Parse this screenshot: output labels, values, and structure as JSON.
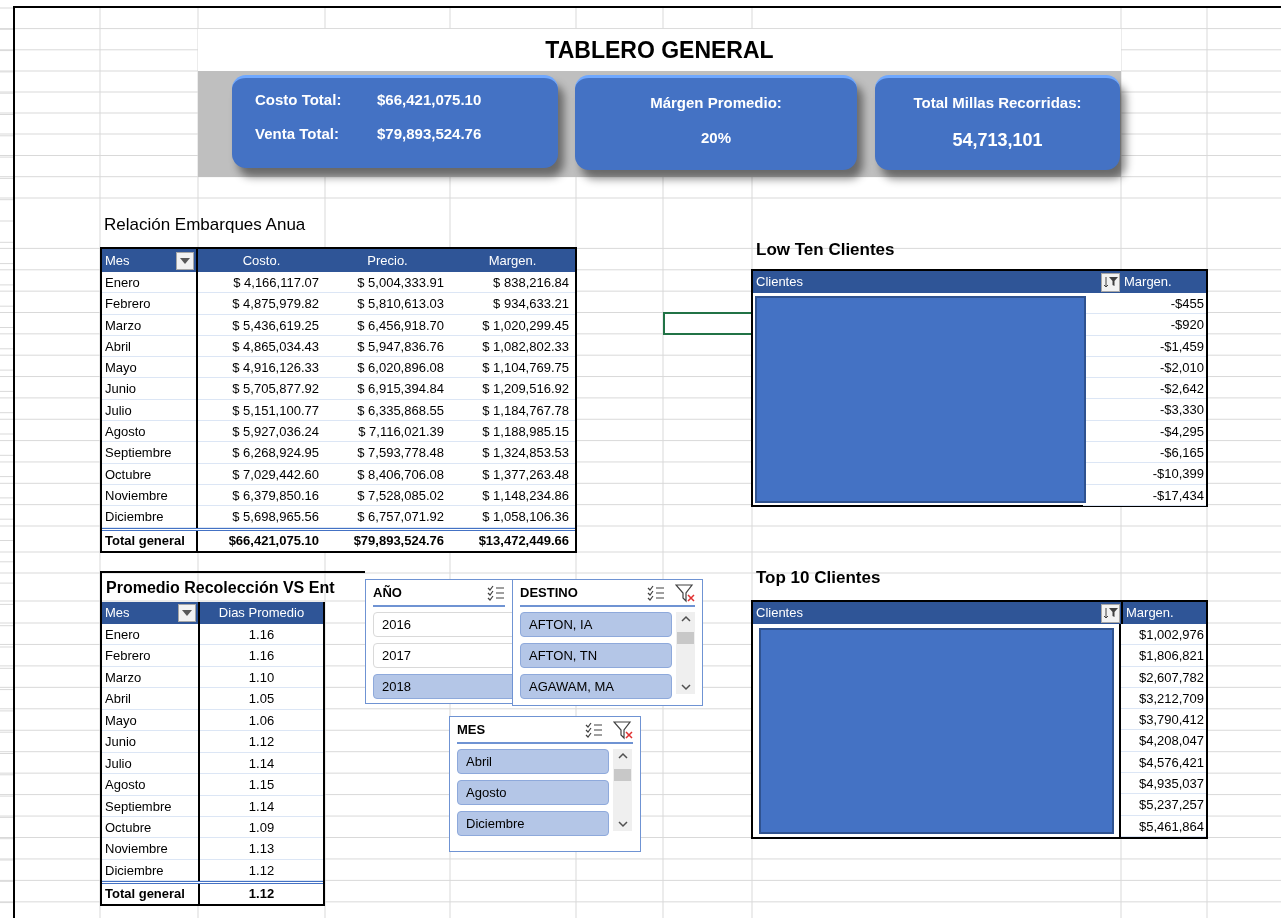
{
  "title": "TABLERO GENERAL",
  "kpi_cards": [
    {
      "kind": "pair",
      "rows": [
        {
          "label": "Costo Total:",
          "value": "$66,421,075.10"
        },
        {
          "label": "Venta Total:",
          "value": "$79,893,524.76"
        }
      ]
    },
    {
      "kind": "stack",
      "label": "Márgen Promedio:",
      "value": "20%",
      "emphasis": false
    },
    {
      "kind": "stack",
      "label": "Total Millas Recorridas:",
      "value": "54,713,101",
      "emphasis": true
    }
  ],
  "shipments_table": {
    "caption": "Relación Embarques Anua",
    "columns": [
      "Mes",
      "Costo.",
      "Precio.",
      "Margen."
    ],
    "rows": [
      [
        "Enero",
        "$ 4,166,117.07",
        "$ 5,004,333.91",
        "$ 838,216.84"
      ],
      [
        "Febrero",
        "$ 4,875,979.82",
        "$ 5,810,613.03",
        "$ 934,633.21"
      ],
      [
        "Marzo",
        "$ 5,436,619.25",
        "$ 6,456,918.70",
        "$ 1,020,299.45"
      ],
      [
        "Abril",
        "$ 4,865,034.43",
        "$ 5,947,836.76",
        "$ 1,082,802.33"
      ],
      [
        "Mayo",
        "$ 4,916,126.33",
        "$ 6,020,896.08",
        "$ 1,104,769.75"
      ],
      [
        "Junio",
        "$ 5,705,877.92",
        "$ 6,915,394.84",
        "$ 1,209,516.92"
      ],
      [
        "Julio",
        "$ 5,151,100.77",
        "$ 6,335,868.55",
        "$ 1,184,767.78"
      ],
      [
        "Agosto",
        "$ 5,927,036.24",
        "$ 7,116,021.39",
        "$ 1,188,985.15"
      ],
      [
        "Septiembre",
        "$ 6,268,924.95",
        "$ 7,593,778.48",
        "$ 1,324,853.53"
      ],
      [
        "Octubre",
        "$ 7,029,442.60",
        "$ 8,406,706.08",
        "$ 1,377,263.48"
      ],
      [
        "Noviembre",
        "$ 6,379,850.16",
        "$ 7,528,085.02",
        "$ 1,148,234.86"
      ],
      [
        "Diciembre",
        "$ 5,698,965.56",
        "$ 6,757,071.92",
        "$ 1,058,106.36"
      ]
    ],
    "total": [
      "Total general",
      "$66,421,075.10",
      "$79,893,524.76",
      "$13,472,449.66"
    ]
  },
  "pickup_table": {
    "caption": "Promedio Recolección VS Ent",
    "columns": [
      "Mes",
      "Dias Promedio"
    ],
    "rows": [
      [
        "Enero",
        "1.16"
      ],
      [
        "Febrero",
        "1.16"
      ],
      [
        "Marzo",
        "1.10"
      ],
      [
        "Abril",
        "1.05"
      ],
      [
        "Mayo",
        "1.06"
      ],
      [
        "Junio",
        "1.12"
      ],
      [
        "Julio",
        "1.14"
      ],
      [
        "Agosto",
        "1.15"
      ],
      [
        "Septiembre",
        "1.14"
      ],
      [
        "Octubre",
        "1.09"
      ],
      [
        "Noviembre",
        "1.13"
      ],
      [
        "Diciembre",
        "1.12"
      ]
    ],
    "total": [
      "Total general",
      "1.12"
    ]
  },
  "slicers": [
    {
      "title": "AÑO",
      "clear_filter_icon": false,
      "scrollbar": false,
      "items": [
        {
          "label": "2016",
          "selected": false
        },
        {
          "label": "2017",
          "selected": false
        },
        {
          "label": "2018",
          "selected": true
        }
      ]
    },
    {
      "title": "DESTINO",
      "clear_filter_icon": true,
      "scrollbar": true,
      "items": [
        {
          "label": "AFTON, IA",
          "selected": true
        },
        {
          "label": "AFTON, TN",
          "selected": true
        },
        {
          "label": "AGAWAM, MA",
          "selected": true
        }
      ]
    },
    {
      "title": "MES",
      "clear_filter_icon": true,
      "scrollbar": true,
      "items": [
        {
          "label": "Abril",
          "selected": true
        },
        {
          "label": "Agosto",
          "selected": true
        },
        {
          "label": "Diciembre",
          "selected": true
        }
      ]
    }
  ],
  "client_tables": [
    {
      "caption": "Low Ten Clientes",
      "columns": [
        "Clientes",
        "Margen."
      ],
      "values": [
        "-$455",
        "-$920",
        "-$1,459",
        "-$2,010",
        "-$2,642",
        "-$3,330",
        "-$4,295",
        "-$6,165",
        "-$10,399",
        "-$17,434"
      ]
    },
    {
      "caption": "Top 10 Clientes",
      "columns": [
        "Clientes",
        "Margen."
      ],
      "values": [
        "$1,002,976",
        "$1,806,821",
        "$2,607,782",
        "$3,212,709",
        "$3,790,412",
        "$4,208,047",
        "$4,576,421",
        "$4,935,037",
        "$5,237,257",
        "$5,461,864"
      ]
    }
  ]
}
